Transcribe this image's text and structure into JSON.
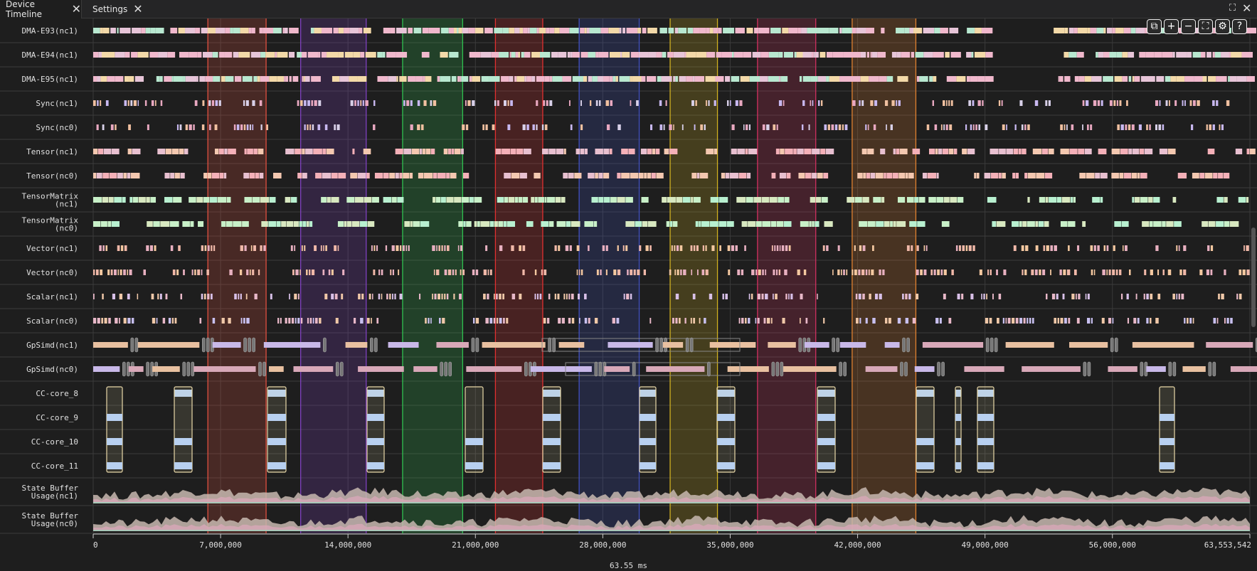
{
  "tabs": [
    {
      "label": "Device Timeline",
      "active": true
    },
    {
      "label": "Settings",
      "active": false
    }
  ],
  "toolbar": {
    "buttons": [
      {
        "name": "reset-view",
        "glyph": "⧉"
      },
      {
        "name": "zoom-in",
        "glyph": "+"
      },
      {
        "name": "zoom-out",
        "glyph": "−"
      },
      {
        "name": "fit-view",
        "glyph": "⛶"
      },
      {
        "name": "settings",
        "glyph": "⚙"
      },
      {
        "name": "help",
        "glyph": "?"
      }
    ]
  },
  "lanes": [
    {
      "label": [
        "DMA-E93(nc1)"
      ],
      "type": "dma",
      "palette": [
        "#f0b8cc",
        "#f0b8cc",
        "#e7c5d8",
        "#f3d9a8",
        "#b8e8d0"
      ],
      "seed": 1
    },
    {
      "label": [
        "DMA-E94(nc1)"
      ],
      "type": "dma",
      "palette": [
        "#f0b8cc",
        "#f0b8cc",
        "#e7c5d8",
        "#f3d9a8",
        "#b8e8d0"
      ],
      "seed": 2
    },
    {
      "label": [
        "DMA-E95(nc1)"
      ],
      "type": "dma",
      "palette": [
        "#f0b8cc",
        "#f0b8cc",
        "#e7c5d8",
        "#f3d9a8",
        "#b8e8d0"
      ],
      "seed": 3
    },
    {
      "label": [
        "Sync(nc1)"
      ],
      "type": "events",
      "palette": [
        "#e8a8c0",
        "#c8b8f0",
        "#f0c0a0",
        "#d8d0e8"
      ],
      "seed": 4
    },
    {
      "label": [
        "Sync(nc0)"
      ],
      "type": "events",
      "palette": [
        "#e8a8c0",
        "#c8b8f0",
        "#f0c0a0",
        "#d8d0e8"
      ],
      "seed": 5
    },
    {
      "label": [
        "Tensor(nc1)"
      ],
      "type": "blocks",
      "palette": [
        "#f4b0b8",
        "#f4c8b0",
        "#e8c0d0"
      ],
      "seed": 6
    },
    {
      "label": [
        "Tensor(nc0)"
      ],
      "type": "blocks",
      "palette": [
        "#f4b0b8",
        "#f4c8b0",
        "#e8c0d0"
      ],
      "seed": 7
    },
    {
      "label": [
        "TensorMatrix",
        "(nc1)"
      ],
      "type": "blocks",
      "palette": [
        "#b8f0d0",
        "#c8f0c8",
        "#d8e8c0"
      ],
      "seed": 8
    },
    {
      "label": [
        "TensorMatrix",
        "(nc0)"
      ],
      "type": "blocks",
      "palette": [
        "#b8f0d0",
        "#c8f0c8",
        "#d8e8c0"
      ],
      "seed": 9
    },
    {
      "label": [
        "Vector(nc1)"
      ],
      "type": "events",
      "palette": [
        "#f0b8a8",
        "#f4c8a0",
        "#e8b0c0"
      ],
      "seed": 10
    },
    {
      "label": [
        "Vector(nc0)"
      ],
      "type": "events",
      "palette": [
        "#f0b8a8",
        "#f4c8a0",
        "#e8b0c0"
      ],
      "seed": 11
    },
    {
      "label": [
        "Scalar(nc1)"
      ],
      "type": "events",
      "palette": [
        "#e8b8c8",
        "#d8c0e8",
        "#f0c8a8"
      ],
      "seed": 12
    },
    {
      "label": [
        "Scalar(nc0)"
      ],
      "type": "events",
      "palette": [
        "#e8b8c8",
        "#c8c0f0",
        "#f0c8a8"
      ],
      "seed": 13
    },
    {
      "label": [
        "GpSimd(nc1)"
      ],
      "type": "gpsimd",
      "palette": [
        "#d8a8b8",
        "#c8b8e8",
        "#e8c0a0"
      ],
      "seed": 14
    },
    {
      "label": [
        "GpSimd(nc0)"
      ],
      "type": "gpsimd",
      "palette": [
        "#d8a8b8",
        "#c8b8e8",
        "#e8c0a0"
      ],
      "seed": 15
    },
    {
      "label": [
        "CC-core_8"
      ],
      "type": "cc",
      "palette": [
        "#b8d0f0"
      ],
      "seed": 16
    },
    {
      "label": [
        "CC-core_9"
      ],
      "type": "cc",
      "palette": [
        "#b8d0f0"
      ],
      "seed": 17
    },
    {
      "label": [
        "CC-core_10"
      ],
      "type": "cc",
      "palette": [
        "#b8d0f0"
      ],
      "seed": 18
    },
    {
      "label": [
        "CC-core_11"
      ],
      "type": "cc",
      "palette": [
        "#b8d0f0"
      ],
      "seed": 19
    },
    {
      "label": [
        "State Buffer",
        "Usage(nc1)"
      ],
      "type": "area",
      "palette": [
        "#c8b8b0",
        "#d8a8b8",
        "#a8c8b8"
      ],
      "seed": 20
    },
    {
      "label": [
        "State Buffer",
        "Usage(nc0)"
      ],
      "type": "area",
      "palette": [
        "#c8b8b0",
        "#d8a8b8",
        "#a8c8b8"
      ],
      "seed": 21
    }
  ],
  "highlights": [
    {
      "start": 6300000,
      "end": 9500000,
      "color": "#e05040"
    },
    {
      "start": 11400000,
      "end": 15000000,
      "color": "#8040c0"
    },
    {
      "start": 17000000,
      "end": 20300000,
      "color": "#30c050"
    },
    {
      "start": 22100000,
      "end": 24700000,
      "color": "#e03030"
    },
    {
      "start": 26700000,
      "end": 30000000,
      "color": "#4050c0"
    },
    {
      "start": 31700000,
      "end": 34300000,
      "color": "#d0b020"
    },
    {
      "start": 36500000,
      "end": 39700000,
      "color": "#d03060"
    },
    {
      "start": 41700000,
      "end": 45200000,
      "color": "#e08030"
    }
  ],
  "axis": {
    "min": 0,
    "max": 63553542,
    "ticks": [
      {
        "value": 0,
        "label": "0"
      },
      {
        "value": 7000000,
        "label": "7,000,000"
      },
      {
        "value": 14000000,
        "label": "14,000,000"
      },
      {
        "value": 21000000,
        "label": "21,000,000"
      },
      {
        "value": 28000000,
        "label": "28,000,000"
      },
      {
        "value": 35000000,
        "label": "35,000,000"
      },
      {
        "value": 42000000,
        "label": "42,000,000"
      },
      {
        "value": 49000000,
        "label": "49,000,000"
      },
      {
        "value": 56000000,
        "label": "56,000,000"
      },
      {
        "value": 63553542,
        "label": "63,553,542"
      }
    ]
  },
  "footer": {
    "duration": "63.55 ms"
  }
}
